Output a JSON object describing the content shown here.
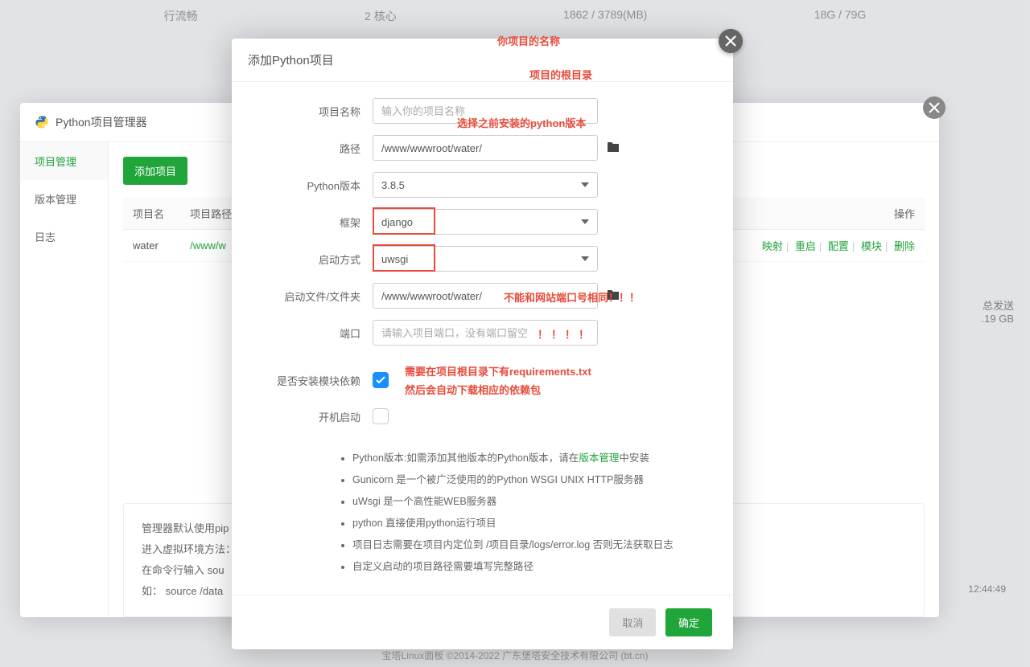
{
  "bg_stats": {
    "stat1": "行流畅",
    "stat2": "2 核心",
    "stat3": "1862 / 3789(MB)",
    "stat4": "18G / 79G"
  },
  "bg_chart": {
    "label": "总发送",
    "value": ".19 GB",
    "time": "12:44:49"
  },
  "manager": {
    "title": "Python项目管理器",
    "sidebar": {
      "project_mgmt": "项目管理",
      "version_mgmt": "版本管理",
      "logs": "日志"
    },
    "add_button": "添加项目",
    "table": {
      "headers": {
        "name": "项目名",
        "path": "项目路径",
        "actions": "操作"
      },
      "row": {
        "name": "water",
        "path": "/www/w",
        "actions": {
          "map": "映射",
          "restart": "重启",
          "config": "配置",
          "module": "模块",
          "delete": "删除"
        }
      }
    },
    "hints": {
      "line1": "管理器默认使用pip",
      "line2": "进入虚拟环境方法：",
      "line3_a": "在命令行输入",
      "line3_b": "sou",
      "line4_a": "如：",
      "line4_b": "source /data"
    }
  },
  "add_modal": {
    "title": "添加Python项目",
    "labels": {
      "project_name": "项目名称",
      "path": "路径",
      "python_version": "Python版本",
      "framework": "框架",
      "start_method": "启动方式",
      "start_file": "启动文件/文件夹",
      "port": "端口",
      "install_deps": "是否安装模块依赖",
      "auto_start": "开机启动"
    },
    "placeholders": {
      "project_name": "输入你的项目名称",
      "port": "请输入项目端口，没有端口留空"
    },
    "values": {
      "path": "/www/wwwroot/water/",
      "python_version": "3.8.5",
      "framework": "django",
      "start_method": "uwsgi",
      "start_file": "/www/wwwroot/water/"
    },
    "annotations": {
      "name": "你项目的名称",
      "path": "项目的根目录",
      "version": "选择之前安装的python版本",
      "port_marks": "！！！！",
      "port_warn": "不能和网站端口号相同！！！",
      "deps1": "需要在项目根目录下有requirements.txt",
      "deps2": "然后会自动下载相应的依赖包"
    },
    "notes": {
      "n1a": "Python版本:如需添加其他版本的Python版本，请在",
      "n1b": "版本管理",
      "n1c": "中安装",
      "n2": "Gunicorn 是一个被广泛使用的的Python WSGI UNIX HTTP服务器",
      "n3": "uWsgi 是一个高性能WEB服务器",
      "n4": "python 直接使用python运行项目",
      "n5": "项目日志需要在项目内定位到 /项目目录/logs/error.log 否则无法获取日志",
      "n6": "自定义启动的项目路径需要填写完整路径"
    },
    "buttons": {
      "cancel": "取消",
      "confirm": "确定"
    }
  },
  "footer": "宝塔Linux面板 ©2014-2022 广东堡塔安全技术有限公司 (bt.cn)"
}
